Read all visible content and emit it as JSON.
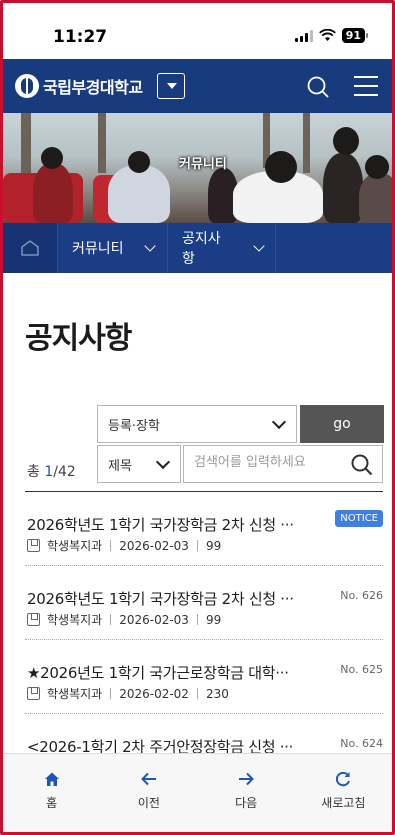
{
  "status_bar": {
    "time": "11:27",
    "battery": "91"
  },
  "header": {
    "logo_text": "국립부경대학교"
  },
  "banner": {
    "title": "커뮤니티"
  },
  "breadcrumb": {
    "items": [
      {
        "label": "커뮤니티"
      },
      {
        "label": "공지사항"
      }
    ]
  },
  "page": {
    "title": "공지사항"
  },
  "filters": {
    "category_selected": "등록·장학",
    "go_label": "go",
    "field_selected": "제목",
    "search_placeholder": "검색어를 입력하세요"
  },
  "count": {
    "prefix": "총 ",
    "current": "1",
    "total": "/42"
  },
  "posts": [
    {
      "title": "2026학년도 1학기 국가장학금 2차 신청 ···",
      "dept": "학생복지과",
      "date": "2026-02-03",
      "views": "99",
      "badge": "NOTICE"
    },
    {
      "title": "2026학년도 1학기 국가장학금 2차 신청 ···",
      "dept": "학생복지과",
      "date": "2026-02-03",
      "views": "99",
      "badge": "No. 626"
    },
    {
      "title": "★2026년도 1학기 국가근로장학금 대학···",
      "dept": "학생복지과",
      "date": "2026-02-02",
      "views": "230",
      "badge": "No. 625"
    },
    {
      "title": "<2026-1학기 2차 주거안정장학금 신청 ···",
      "badge": "No. 624"
    }
  ],
  "toolbar": {
    "items": [
      {
        "label": "홈"
      },
      {
        "label": "이전"
      },
      {
        "label": "다음"
      },
      {
        "label": "새로고침"
      }
    ]
  },
  "colors": {
    "brand_navy": "#173b7c",
    "notice_blue": "#3f7fe0",
    "accent_blue": "#1a57c6",
    "frame_red": "#c8102e"
  }
}
